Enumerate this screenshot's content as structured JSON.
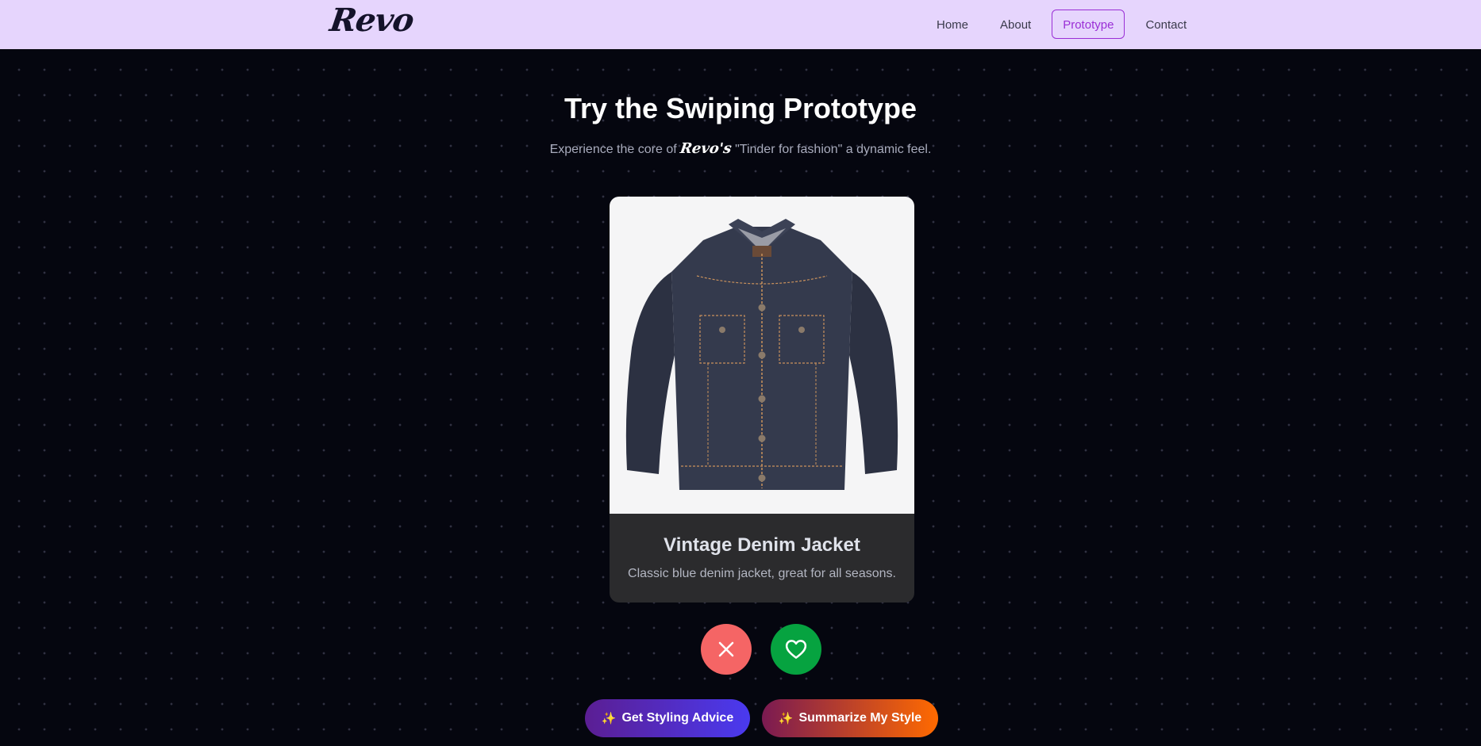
{
  "nav": {
    "logo": "Revo",
    "links": [
      {
        "label": "Home"
      },
      {
        "label": "About"
      },
      {
        "label": "Prototype",
        "active": true
      },
      {
        "label": "Contact"
      }
    ]
  },
  "hero": {
    "title": "Try the Swiping Prototype",
    "subtitle_pre": "Experience the core of ",
    "subtitle_brand": "Revo's",
    "subtitle_post": " \"Tinder for fashion\" a dynamic feel."
  },
  "card": {
    "image_icon": "denim-jacket-image",
    "title": "Vintage Denim Jacket",
    "description": "Classic blue denim jacket, great for all seasons."
  },
  "actions": {
    "dislike_icon": "close-icon",
    "like_icon": "heart-icon"
  },
  "buttons": {
    "styling_icon": "sparkles-icon",
    "styling_label": "Get Styling Advice",
    "summary_icon": "sparkles-icon",
    "summary_label": "Summarize My Style"
  },
  "colors": {
    "nav_bg": "#e6d5fd",
    "page_bg": "#05060f",
    "active_accent": "#9a2fd6",
    "dislike": "#f56565",
    "like": "#06a340"
  }
}
